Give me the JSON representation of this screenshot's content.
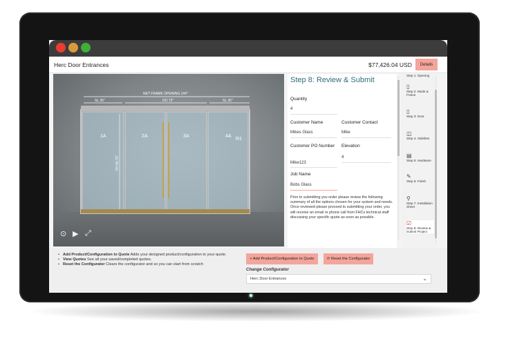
{
  "app": {
    "title": "Herc Door Entrances",
    "price": "$77,426.04 USD",
    "details_label": "Details"
  },
  "viewer": {
    "dimensions": {
      "net_frame": "NET FRAME OPENING 144\"",
      "left": "SL 36\"",
      "center": "DO 72\"",
      "right": "SL 36\"",
      "height": "FH 96.75\""
    },
    "panels": [
      "1A",
      "2A",
      "3A",
      "4A",
      "R1"
    ],
    "controls": {
      "ar_icon": "ar-icon",
      "play_icon": "play-icon",
      "fullscreen_icon": "fullscreen-icon"
    }
  },
  "form": {
    "step_title": "Step 8: Review & Submit",
    "quantity_label": "Quantity",
    "quantity_value": "4",
    "customer_name_label": "Customer Name",
    "customer_name_value": "Mikes Glass",
    "customer_contact_label": "Customer Contact",
    "customer_contact_value": "Mike",
    "po_label": "Customer PO Number",
    "po_value": "Mike123",
    "elevation_label": "Elevation",
    "elevation_value": "4",
    "job_name_label": "Job Name",
    "job_name_value": "Bobs Glass",
    "description": "Prior to submitting you order please review the following summary of all the options chosen for your system and needs. Once reviewed please proceed to submitting your order, you will receive an email or phone call from FHCs technical staff discussing your specific quote as soon as possible."
  },
  "steps": [
    {
      "label": "Step 1: Opening",
      "icon": "opening-icon"
    },
    {
      "label": "Step 2: Mode & Frame",
      "icon": "frame-icon"
    },
    {
      "label": "Step 3: Door",
      "icon": "door-icon"
    },
    {
      "label": "Step 4: Sidelites",
      "icon": "sidelite-icon"
    },
    {
      "label": "Step 5: Hardware",
      "icon": "hardware-icon"
    },
    {
      "label": "Step 6: Finish",
      "icon": "finish-icon"
    },
    {
      "label": "Step 7: Installation Sheet",
      "icon": "installation-icon"
    },
    {
      "label": "Step 8: Review & Submit Project",
      "icon": "review-icon"
    }
  ],
  "help": {
    "item1_bold": "Add Product/Configuration to Quote",
    "item1_text": " Adds your designed product/configuration to your quote.",
    "item2_bold": "View Quotes",
    "item2_text": " See all your saved/completed quotes.",
    "item3_bold": "Reset the Configurator",
    "item3_text": " Clears the configurator and so you can start from scratch"
  },
  "actions": {
    "add_label": "+ Add Product/Configuration to Quote",
    "reset_label": "⟳ Reset the Configurator"
  },
  "configurator": {
    "label": "Change Configurator",
    "value": "Herc Door Entrances"
  },
  "colors": {
    "accent": "#f4a59b",
    "title_teal": "#2f6c7e"
  }
}
